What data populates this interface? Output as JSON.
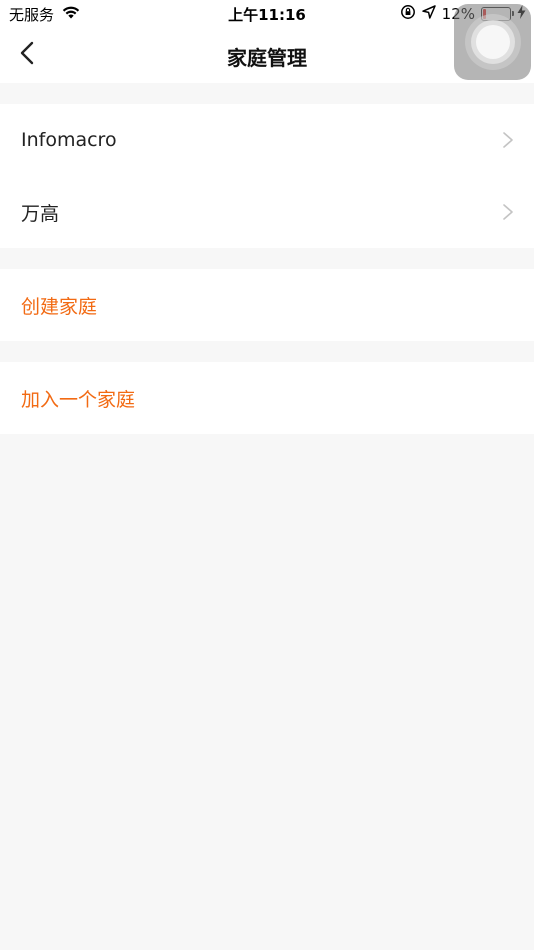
{
  "status_bar": {
    "carrier": "无服务",
    "time": "上午11:16",
    "battery_percent": "12%",
    "battery_level": 0.12,
    "icons": [
      "wifi-icon",
      "orientation-lock-icon",
      "location-arrow-icon",
      "battery-icon",
      "charging-bolt-icon"
    ]
  },
  "nav": {
    "title": "家庭管理",
    "back_icon": "chevron-left-icon"
  },
  "families": [
    {
      "name": "Infomacro"
    },
    {
      "name": "万高"
    }
  ],
  "actions": {
    "create_family": "创建家庭",
    "join_family": "加入一个家庭"
  },
  "colors": {
    "accent": "#f26a13",
    "background": "#f7f7f7",
    "card": "#ffffff",
    "battery_low": "#e53935"
  }
}
